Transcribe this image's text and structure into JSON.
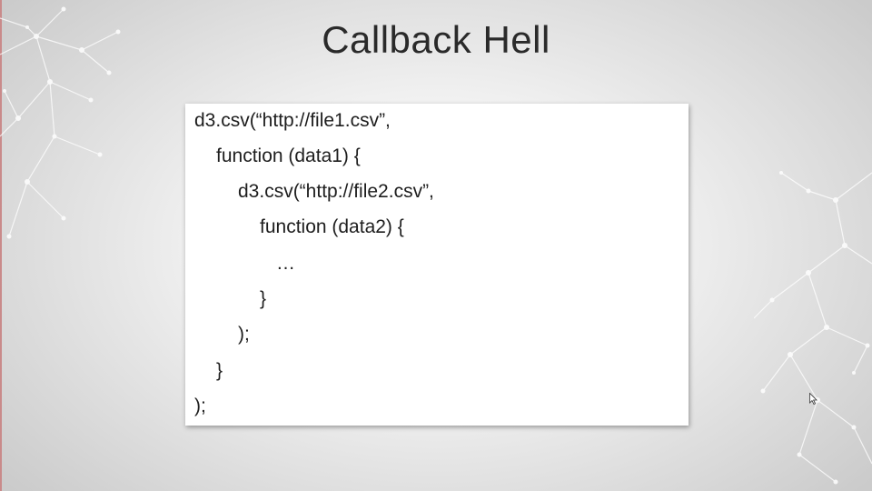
{
  "slide": {
    "title": "Callback Hell"
  },
  "code": {
    "lines": [
      "d3.csv(“http://file1.csv”,",
      "function (data1) {",
      "d3.csv(“http://file2.csv”,",
      "function (data2) {",
      "…",
      "}",
      ");",
      "}",
      ");"
    ]
  },
  "icons": {
    "decor_left": "network-graph-decoration",
    "decor_right": "network-graph-decoration",
    "cursor": "mouse-pointer-icon"
  },
  "colors": {
    "background": "#e6e6e6",
    "accent_edge": "#c98a8a",
    "text": "#1e1e1e"
  }
}
